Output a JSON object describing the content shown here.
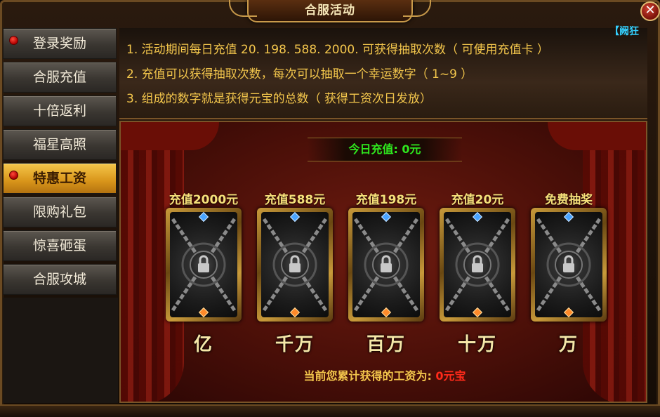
{
  "window": {
    "title": "合服活动",
    "close_label": "✕"
  },
  "corner_tag": "【阙狂",
  "sidebar": {
    "items": [
      {
        "label": "登录奖励",
        "dot": true,
        "active": false
      },
      {
        "label": "合服充值",
        "dot": false,
        "active": false
      },
      {
        "label": "十倍返利",
        "dot": false,
        "active": false
      },
      {
        "label": "福星高照",
        "dot": false,
        "active": false
      },
      {
        "label": "特惠工资",
        "dot": true,
        "active": true
      },
      {
        "label": "限购礼包",
        "dot": false,
        "active": false
      },
      {
        "label": "惊喜砸蛋",
        "dot": false,
        "active": false
      },
      {
        "label": "合服攻城",
        "dot": false,
        "active": false
      }
    ]
  },
  "rules": [
    "1. 活动期间每日充值 20. 198. 588. 2000. 可获得抽取次数（ 可使用充值卡 ）",
    "2. 充值可以获得抽取次数，每次可以抽取一个幸运数字（ 1~9 ）",
    "3. 组成的数字就是获得元宝的总数（ 获得工资次日发放）"
  ],
  "today_recharge": {
    "label": "今日充值:",
    "value": "0元"
  },
  "cards": [
    {
      "label": "充值2000元",
      "digit": "亿"
    },
    {
      "label": "充值588元",
      "digit": "千万"
    },
    {
      "label": "充值198元",
      "digit": "百万"
    },
    {
      "label": "充值20元",
      "digit": "十万"
    },
    {
      "label": "免费抽奖",
      "digit": "万"
    }
  ],
  "total": {
    "label": "当前您累计获得的工资为:",
    "value": "0元宝"
  },
  "colors": {
    "accent_gold": "#f3c64c",
    "green": "#2fe81e",
    "red": "#ff2a1a",
    "active_tab": "#d8951a",
    "link_blue": "#34d0ff"
  }
}
